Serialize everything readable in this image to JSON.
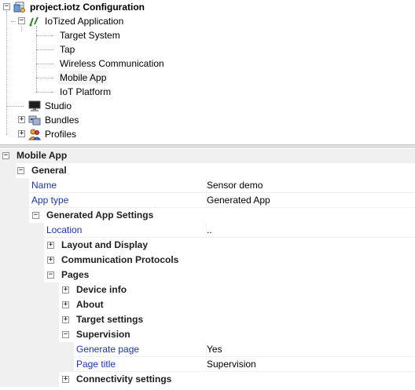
{
  "tree": {
    "root": {
      "label": "project.iotz Configuration",
      "icon": "project-config-icon"
    },
    "app": {
      "label": "IoTized Application",
      "icon": "iotized-app-icon"
    },
    "app_children": [
      {
        "label": "Target System"
      },
      {
        "label": "Tap"
      },
      {
        "label": "Wireless Communication"
      },
      {
        "label": "Mobile App"
      },
      {
        "label": "IoT Platform"
      }
    ],
    "studio": {
      "label": "Studio",
      "icon": "studio-monitor-icon"
    },
    "bundles": {
      "label": "Bundles",
      "icon": "bundles-icon"
    },
    "profiles": {
      "label": "Profiles",
      "icon": "profiles-icon"
    }
  },
  "props": {
    "section": "Mobile App",
    "general": "General",
    "name_label": "Name",
    "name_value": "Sensor demo",
    "apptype_label": "App type",
    "apptype_value": "Generated App",
    "gen_settings": "Generated App Settings",
    "location_label": "Location",
    "location_value": "..",
    "layout": "Layout and Display",
    "comm": "Communication Protocols",
    "pages": "Pages",
    "device_info": "Device info",
    "about": "About",
    "target_settings": "Target settings",
    "supervision": "Supervision",
    "gen_page_label": "Generate page",
    "gen_page_value": "Yes",
    "page_title_label": "Page title",
    "page_title_value": "Supervision",
    "connectivity": "Connectivity settings"
  }
}
